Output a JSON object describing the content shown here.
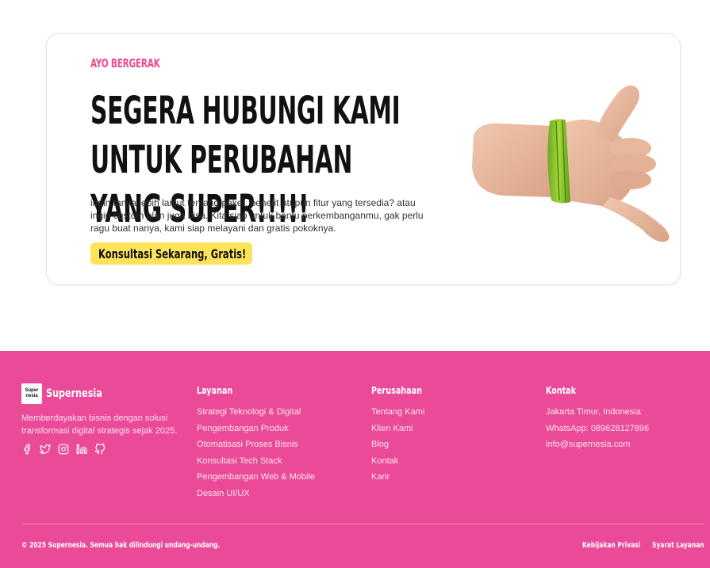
{
  "cta": {
    "eyebrow": "AYO BERGERAK",
    "headline": "SEGERA HUBUNGI KAMI UNTUK PERUBAHAN YANG SUPER!!!!!",
    "description": "ingin tanya lebih lanjut tentang paket, benefit atupun fitur yang tersedia? atau ingin custom plan juga bisa. Kita siap untuk bantu perkembanganmu, gak perlu ragu buat nanya, kami siap melayani dan gratis pokoknya.",
    "button_label": "Konsultasi Sekarang, Gratis!",
    "illustration_icon": "shaka-hand-illustration"
  },
  "footer": {
    "brand": {
      "logo_text": "Super nesia",
      "name": "Supernesia",
      "tagline": "Memberdayakan bisnis dengan solusi transformasi digital strategis sejak 2025."
    },
    "socials": [
      "facebook-icon",
      "twitter-icon",
      "instagram-icon",
      "linkedin-icon",
      "github-icon"
    ],
    "columns": [
      {
        "title": "Layanan",
        "items": [
          "Strategi Teknologi & Digital",
          "Pengembangan Produk",
          "Otomatisasi Proses Bisnis",
          "Konsultasi Tech Stack",
          "Pengembangan Web & Mobile",
          "Desain UI/UX"
        ]
      },
      {
        "title": "Perusahaan",
        "items": [
          "Tentang Kami",
          "Klien Kami",
          "Blog",
          "Kontak",
          "Karir"
        ]
      },
      {
        "title": "Kontak",
        "items": [
          "Jakarta Timur, Indonesia",
          "WhatsApp: 089628127896",
          "info@supernesia.com"
        ]
      }
    ],
    "copyright": "© 2025 Supernesia. Semua hak dilindungi undang-undang.",
    "legal": {
      "privacy": "Kebijakan Privasi",
      "terms": "Syarat Layanan"
    }
  },
  "colors": {
    "accent_pink": "#ea4a97",
    "eyebrow_pink": "#ec4b8f",
    "button_yellow": "#fde25b"
  }
}
